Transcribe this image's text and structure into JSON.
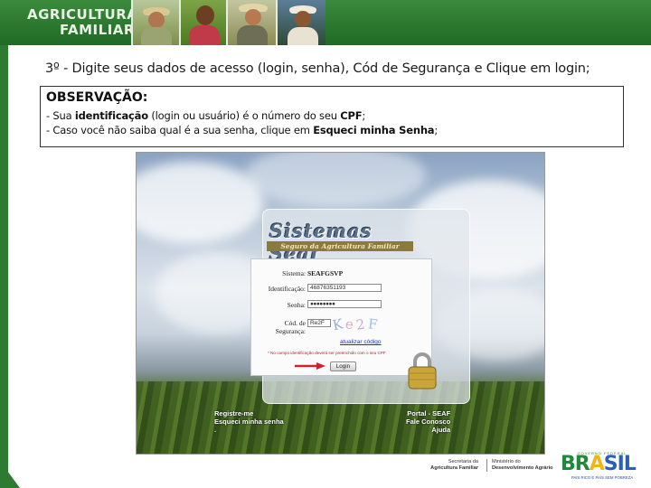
{
  "banner": {
    "title_line1": "AGRICULTURA",
    "title_line2": "FAMILIAR"
  },
  "step_text": "3º - Digite seus dados de acesso (login, senha), Cód de Segurança e Clique em login;",
  "observation": {
    "title": "OBSERVAÇÃO:",
    "line1_prefix": "- Sua ",
    "line1_bold1": "identificação",
    "line1_mid": " (login ou usuário) é o número do seu ",
    "line1_bold2": "CPF",
    "line1_end": ";",
    "line2_prefix": "- Caso você não saiba qual é a sua senha, clique em ",
    "line2_bold": "Esqueci minha Senha",
    "line2_end": ";"
  },
  "login_screenshot": {
    "logo_main": "Sistemas Seaf",
    "logo_sub": "Seguro da Agricultura Familiar",
    "sistema_label": "Sistema:",
    "sistema_value": "SEAFGSVP",
    "identificacao_label": "Identificação:",
    "identificacao_value": "46876351193",
    "senha_label": "Senha:",
    "senha_value": "●●●●●●●●",
    "codigo_label_1": "Cód. de",
    "codigo_label_2": "Segurança:",
    "codigo_value": "Re2F",
    "captcha_text": [
      "K",
      "e",
      "2",
      "F"
    ],
    "atualizar_link": "atualizar código",
    "warning": "* No campo identificação deverá ser preenchido com o seu CPF",
    "login_button": "Login",
    "footer_left": [
      "Registre-me",
      "Esqueci minha senha",
      "."
    ],
    "footer_right": [
      "Portal - SEAF",
      "Fale Conosco",
      "Ajuda"
    ]
  },
  "footer": {
    "sec_line1": "Secretaria da",
    "sec_line2": "Agricultura Familiar",
    "min_line1": "Ministério do",
    "min_line2": "Desenvolvimento Agrário",
    "gov_label": "GOVERNO FEDERAL",
    "brasil_parts": [
      "BR",
      "A",
      "SIL"
    ],
    "slogan": "PAÍS RICO É PAÍS SEM POBREZA"
  },
  "colors": {
    "banner_green": "#2b7a2f",
    "link_blue": "#1a36b8",
    "warning_red": "#c0202a"
  }
}
